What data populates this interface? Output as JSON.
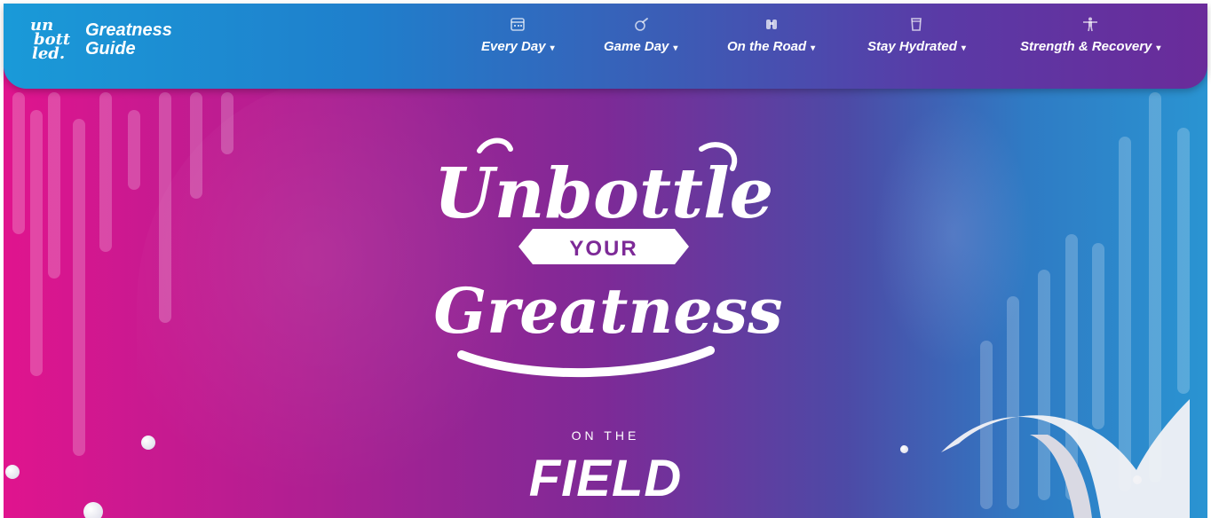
{
  "brand": {
    "line1": "Greatness",
    "line2": "Guide",
    "logo_text": "un bott led."
  },
  "nav": [
    {
      "label": "Every Day",
      "icon": "calendar-icon"
    },
    {
      "label": "Game Day",
      "icon": "whistle-icon"
    },
    {
      "label": "On the Road",
      "icon": "binoculars-icon"
    },
    {
      "label": "Stay Hydrated",
      "icon": "cup-icon"
    },
    {
      "label": "Strength & Recovery",
      "icon": "weightlifter-icon"
    }
  ],
  "hero": {
    "title_line1": "Unbottle",
    "title_line2": "YOUR",
    "title_line3": "Greatness",
    "eyebrow": "ON THE",
    "headline": "FIELD"
  },
  "colors": {
    "pink": "#e0148e",
    "purple": "#7d2a97",
    "blue": "#2a94d2"
  }
}
